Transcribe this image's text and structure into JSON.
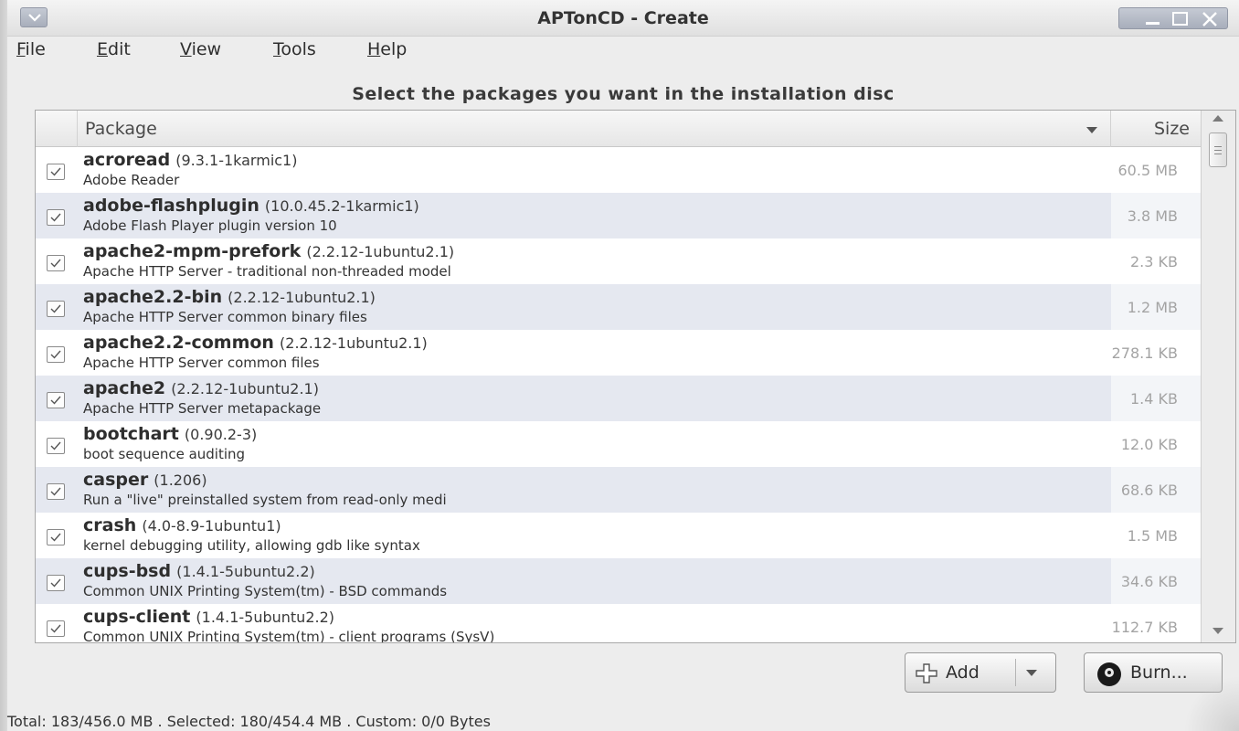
{
  "window": {
    "title": "APTonCD - Create"
  },
  "menu": [
    {
      "label": "File",
      "mnemonic": "F",
      "rest": "ile"
    },
    {
      "label": "Edit",
      "mnemonic": "E",
      "rest": "dit"
    },
    {
      "label": "View",
      "mnemonic": "V",
      "rest": "iew"
    },
    {
      "label": "Tools",
      "mnemonic": "T",
      "rest": "ools"
    },
    {
      "label": "Help",
      "mnemonic": "H",
      "rest": "elp"
    }
  ],
  "instructions": "Select the packages you want in the installation disc",
  "table": {
    "columns": {
      "package": "Package",
      "size": "Size"
    },
    "rows": [
      {
        "checked": true,
        "name": "acroread",
        "version": "(9.3.1-1karmic1)",
        "description": "Adobe Reader",
        "size": "60.5 MB"
      },
      {
        "checked": true,
        "name": "adobe-flashplugin",
        "version": "(10.0.45.2-1karmic1)",
        "description": "Adobe Flash Player plugin version 10",
        "size": "3.8 MB"
      },
      {
        "checked": true,
        "name": "apache2-mpm-prefork",
        "version": "(2.2.12-1ubuntu2.1)",
        "description": "Apache HTTP Server - traditional non-threaded model",
        "size": "2.3 KB"
      },
      {
        "checked": true,
        "name": "apache2.2-bin",
        "version": "(2.2.12-1ubuntu2.1)",
        "description": "Apache HTTP Server common binary files",
        "size": "1.2 MB"
      },
      {
        "checked": true,
        "name": "apache2.2-common",
        "version": "(2.2.12-1ubuntu2.1)",
        "description": "Apache HTTP Server common files",
        "size": "278.1 KB"
      },
      {
        "checked": true,
        "name": "apache2",
        "version": "(2.2.12-1ubuntu2.1)",
        "description": "Apache HTTP Server metapackage",
        "size": "1.4 KB"
      },
      {
        "checked": true,
        "name": "bootchart",
        "version": "(0.90.2-3)",
        "description": "boot sequence auditing",
        "size": "12.0 KB"
      },
      {
        "checked": true,
        "name": "casper",
        "version": "(1.206)",
        "description": "Run a \"live\" preinstalled system from read-only medi",
        "size": "68.6 KB"
      },
      {
        "checked": true,
        "name": "crash",
        "version": "(4.0-8.9-1ubuntu1)",
        "description": "kernel debugging utility, allowing gdb like syntax",
        "size": "1.5 MB"
      },
      {
        "checked": true,
        "name": "cups-bsd",
        "version": "(1.4.1-5ubuntu2.2)",
        "description": "Common UNIX Printing System(tm) - BSD commands",
        "size": "34.6 KB"
      },
      {
        "checked": true,
        "name": "cups-client",
        "version": "(1.4.1-5ubuntu2.2)",
        "description": "Common UNIX Printing System(tm) - client programs (SysV)",
        "size": "112.7 KB"
      }
    ]
  },
  "buttons": {
    "add_label": "Add",
    "burn_label": "Burn..."
  },
  "status": "Total: 183/456.0 MB  .  Selected: 180/454.4 MB  .  Custom: 0/0 Bytes",
  "colors": {
    "row_alt": "#e5e8f0",
    "titlebar_button": "#a8aebb"
  }
}
